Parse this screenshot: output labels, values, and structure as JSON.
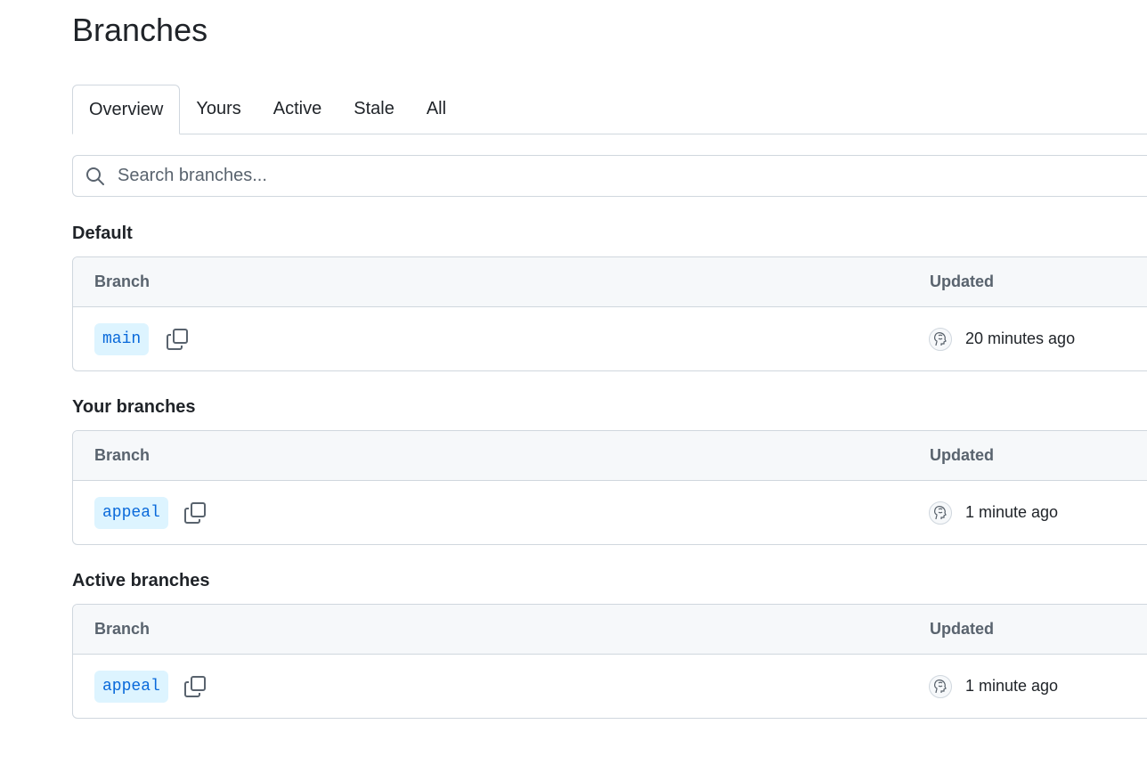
{
  "page": {
    "title": "Branches"
  },
  "tabs": [
    {
      "label": "Overview",
      "selected": true
    },
    {
      "label": "Yours",
      "selected": false
    },
    {
      "label": "Active",
      "selected": false
    },
    {
      "label": "Stale",
      "selected": false
    },
    {
      "label": "All",
      "selected": false
    }
  ],
  "search": {
    "placeholder": "Search branches...",
    "value": "",
    "icon": "search-icon"
  },
  "sections": [
    {
      "title": "Default",
      "columns": {
        "branch": "Branch",
        "updated": "Updated"
      },
      "rows": [
        {
          "branch": "main",
          "updated": "20 minutes ago"
        }
      ]
    },
    {
      "title": "Your branches",
      "columns": {
        "branch": "Branch",
        "updated": "Updated"
      },
      "rows": [
        {
          "branch": "appeal",
          "updated": "1 minute ago"
        }
      ]
    },
    {
      "title": "Active branches",
      "columns": {
        "branch": "Branch",
        "updated": "Updated"
      },
      "rows": [
        {
          "branch": "appeal",
          "updated": "1 minute ago"
        }
      ]
    }
  ],
  "colors": {
    "branch_pill_bg": "#ddf4ff",
    "branch_pill_text": "#0969da",
    "header_bg": "#f6f8fa",
    "border": "#d0d7de"
  }
}
